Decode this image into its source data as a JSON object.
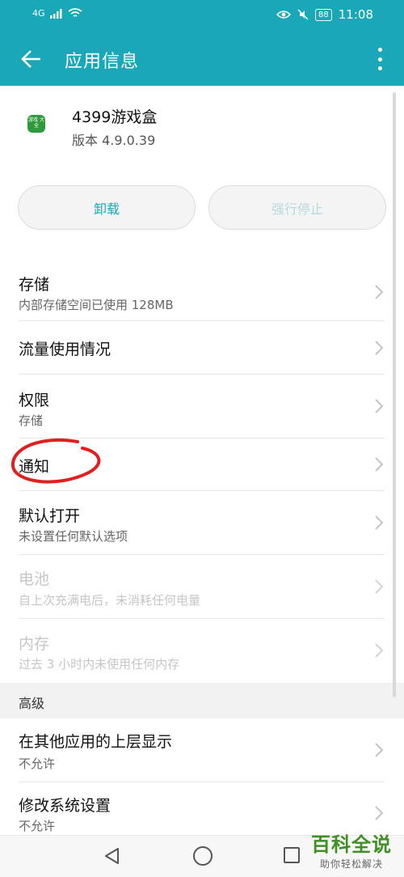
{
  "status_bar": {
    "signal": "4G",
    "battery": "88",
    "time": "11:08"
  },
  "app_bar": {
    "title": "应用信息"
  },
  "app": {
    "name": "4399游戏盒",
    "version": "版本 4.9.0.39",
    "icon_text": "游戏 大全"
  },
  "buttons": {
    "uninstall": "卸载",
    "force_stop": "强行停止"
  },
  "rows": [
    {
      "title": "存储",
      "subtitle": "内部存储空间已使用 128MB"
    },
    {
      "title": "流量使用情况",
      "subtitle": ""
    },
    {
      "title": "权限",
      "subtitle": "存储"
    },
    {
      "title": "通知",
      "subtitle": ""
    },
    {
      "title": "默认打开",
      "subtitle": "未设置任何默认选项"
    },
    {
      "title": "电池",
      "subtitle": "自上次充满电后，未消耗任何电量"
    },
    {
      "title": "内存",
      "subtitle": "过去 3 小时内未使用任何内存"
    }
  ],
  "advanced": {
    "label": "高级",
    "rows": [
      {
        "title": "在其他应用的上层显示",
        "subtitle": "不允许"
      },
      {
        "title": "修改系统设置",
        "subtitle": "不允许"
      }
    ]
  },
  "colors": {
    "accent": "#1aa8b8",
    "annotation": "#e02020"
  },
  "watermark": {
    "title": "百科全说",
    "subtitle": "助你轻松解决"
  }
}
